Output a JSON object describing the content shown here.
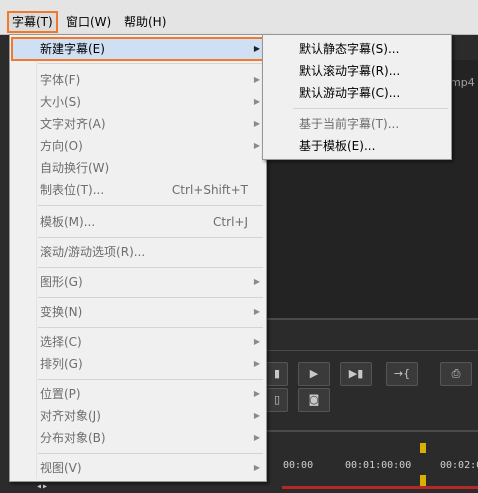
{
  "menubar": {
    "items": [
      {
        "label": "字幕(T)"
      },
      {
        "label": "窗口(W)"
      },
      {
        "label": "帮助(H)"
      }
    ]
  },
  "menu": {
    "items": [
      {
        "label": "新建字幕(E)",
        "shortcut": "",
        "submenu": true,
        "disabled": false
      },
      {
        "label": "字体(F)",
        "shortcut": "",
        "submenu": true,
        "disabled": true
      },
      {
        "label": "大小(S)",
        "shortcut": "",
        "submenu": true,
        "disabled": true
      },
      {
        "label": "文字对齐(A)",
        "shortcut": "",
        "submenu": true,
        "disabled": true
      },
      {
        "label": "方向(O)",
        "shortcut": "",
        "submenu": true,
        "disabled": true
      },
      {
        "label": "自动换行(W)",
        "shortcut": "",
        "submenu": false,
        "disabled": true
      },
      {
        "label": "制表位(T)...",
        "shortcut": "Ctrl+Shift+T",
        "submenu": false,
        "disabled": true
      },
      {
        "label": "模板(M)...",
        "shortcut": "Ctrl+J",
        "submenu": false,
        "disabled": true
      },
      {
        "label": "滚动/游动选项(R)...",
        "shortcut": "",
        "submenu": false,
        "disabled": true
      },
      {
        "label": "图形(G)",
        "shortcut": "",
        "submenu": true,
        "disabled": true
      },
      {
        "label": "变换(N)",
        "shortcut": "",
        "submenu": true,
        "disabled": true
      },
      {
        "label": "选择(C)",
        "shortcut": "",
        "submenu": true,
        "disabled": true
      },
      {
        "label": "排列(G)",
        "shortcut": "",
        "submenu": true,
        "disabled": true
      },
      {
        "label": "位置(P)",
        "shortcut": "",
        "submenu": true,
        "disabled": true
      },
      {
        "label": "对齐对象(J)",
        "shortcut": "",
        "submenu": true,
        "disabled": true
      },
      {
        "label": "分布对象(B)",
        "shortcut": "",
        "submenu": true,
        "disabled": true
      },
      {
        "label": "视图(V)",
        "shortcut": "",
        "submenu": true,
        "disabled": true
      }
    ]
  },
  "submenu": {
    "items": [
      {
        "label": "默认静态字幕(S)...",
        "disabled": false
      },
      {
        "label": "默认滚动字幕(R)...",
        "disabled": false
      },
      {
        "label": "默认游动字幕(C)...",
        "disabled": false
      },
      {
        "label": "基于当前字幕(T)...",
        "disabled": true
      },
      {
        "label": "基于模板(E)...",
        "disabled": false
      }
    ]
  },
  "background": {
    "file_suffix": "mp4",
    "timeline": {
      "t0": "00:00",
      "t1": "00:01:00:00",
      "t2": "00:02:0"
    }
  },
  "colors": {
    "highlight_outline": "#f0792c",
    "menu_bg": "#f0f0f0",
    "app_bg": "#2b2b2b"
  }
}
